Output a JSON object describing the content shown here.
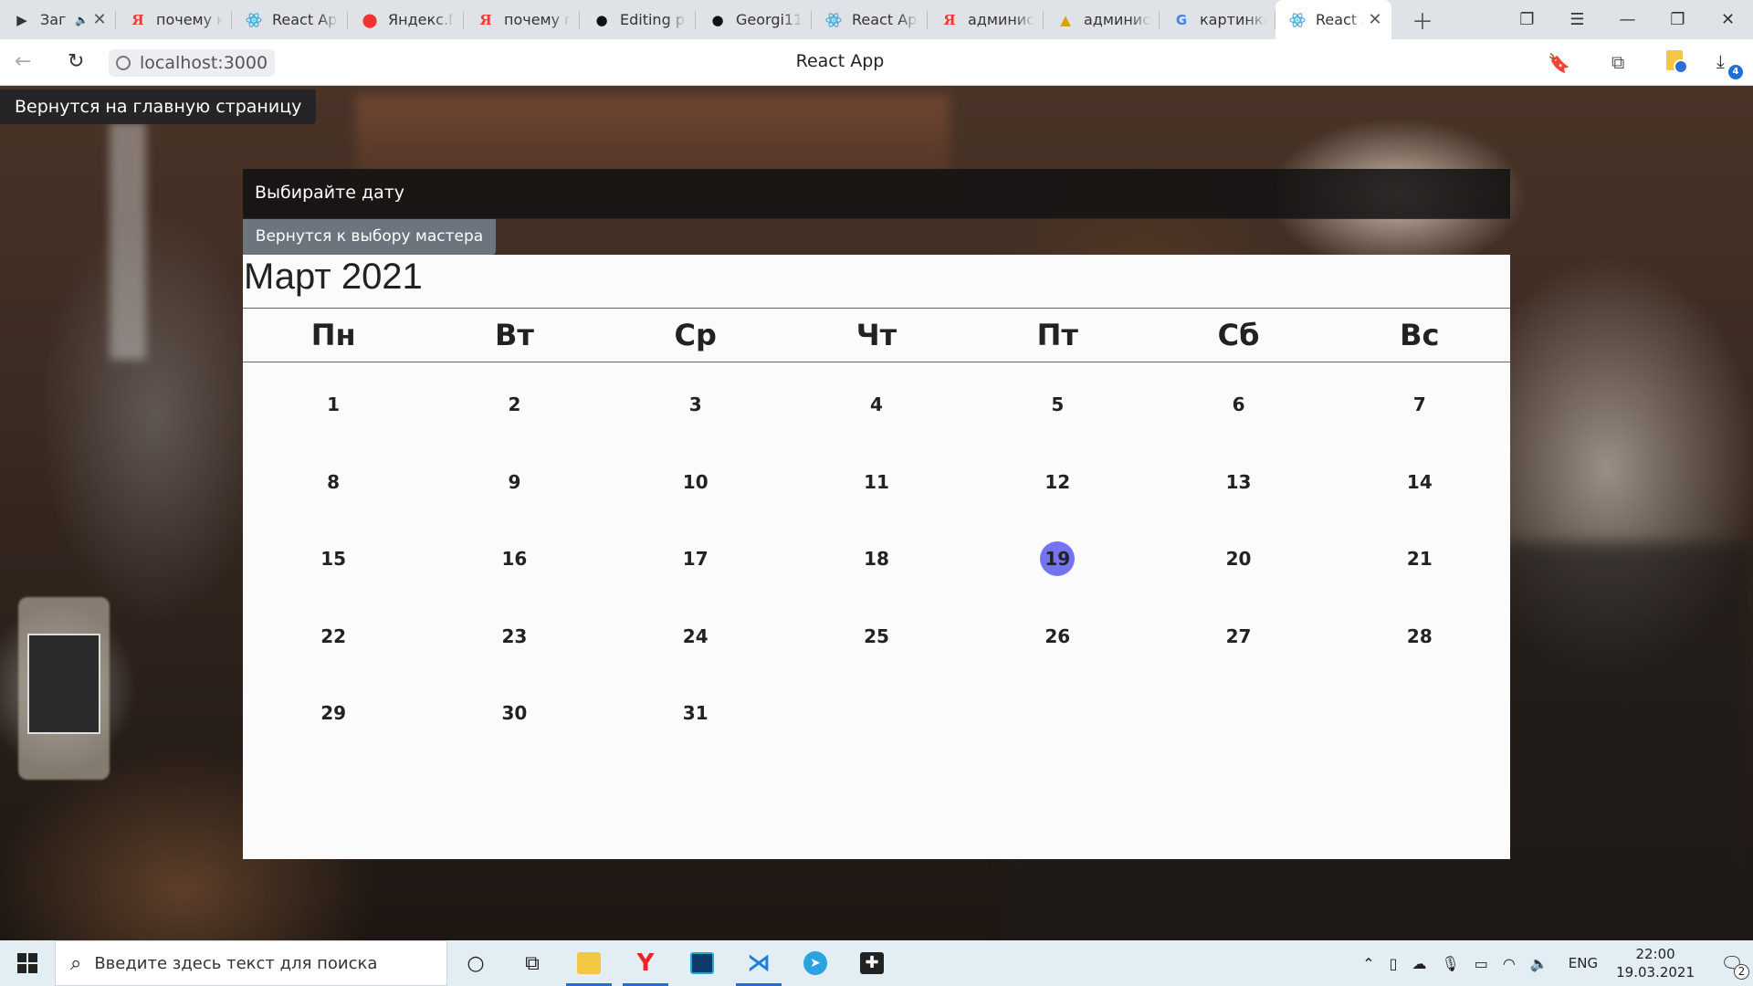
{
  "browser": {
    "tabs": [
      {
        "label": "Заг",
        "icon": "youtube-play-icon",
        "extra": "🔈"
      },
      {
        "label": "почему к",
        "icon": "yandex-icon"
      },
      {
        "label": "React App",
        "icon": "react-icon"
      },
      {
        "label": "Яндекс.П",
        "icon": "yandex-maps-icon"
      },
      {
        "label": "почему г",
        "icon": "yandex-icon"
      },
      {
        "label": "Editing p",
        "icon": "github-icon"
      },
      {
        "label": "Georgi11",
        "icon": "github-icon"
      },
      {
        "label": "React App",
        "icon": "react-icon"
      },
      {
        "label": "админист",
        "icon": "yandex-icon"
      },
      {
        "label": "админист",
        "icon": "image-icon"
      },
      {
        "label": "картинки",
        "icon": "google-icon"
      },
      {
        "label": "React A",
        "icon": "react-icon",
        "active": true
      }
    ],
    "url": "localhost:3000",
    "page_title": "React App",
    "downloads_count": "4"
  },
  "page": {
    "home_link": "Вернутся на главную страницу",
    "panel_title": "Выбирайте дату",
    "back_to_master": "Вернутся к выбору мастера"
  },
  "calendar": {
    "month_title": "Март 2021",
    "weekdays": [
      "Пн",
      "Вт",
      "Ср",
      "Чт",
      "Пт",
      "Сб",
      "Вс"
    ],
    "days": [
      "1",
      "2",
      "3",
      "4",
      "5",
      "6",
      "7",
      "8",
      "9",
      "10",
      "11",
      "12",
      "13",
      "14",
      "15",
      "16",
      "17",
      "18",
      "19",
      "20",
      "21",
      "22",
      "23",
      "24",
      "25",
      "26",
      "27",
      "28",
      "29",
      "30",
      "31"
    ],
    "selected_day": "19",
    "selected_color": "#7474f0"
  },
  "taskbar": {
    "search_placeholder": "Введите здесь текст для поиска",
    "language": "ENG",
    "time": "22:00",
    "date": "19.03.2021",
    "notifications": "2"
  }
}
